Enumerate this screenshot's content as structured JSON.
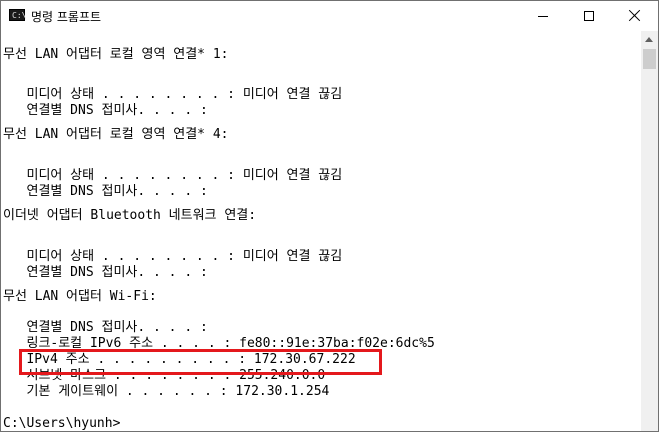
{
  "window": {
    "title": "명령 프롬프트",
    "icon_label": "C:\\",
    "icon": "console-app-icon"
  },
  "titlebar_buttons": {
    "minimize": "minimize-icon",
    "maximize": "maximize-icon",
    "close": "close-icon"
  },
  "console": {
    "lines": [
      "무선 LAN 어댑터 로컬 영역 연결* 1:",
      "",
      "   미디어 상태 . . . . . . . . : 미디어 연결 끊김",
      "   연결별 DNS 접미사. . . . :",
      "",
      "무선 LAN 어댑터 로컬 영역 연결* 4:",
      "",
      "   미디어 상태 . . . . . . . . : 미디어 연결 끊김",
      "   연결별 DNS 접미사. . . . :",
      "",
      "이더넷 어댑터 Bluetooth 네트워크 연결:",
      "",
      "   미디어 상태 . . . . . . . . : 미디어 연결 끊김",
      "   연결별 DNS 접미사. . . . :",
      "",
      "무선 LAN 어댑터 Wi-Fi:",
      "",
      "   연결별 DNS 접미사. . . . :",
      "   링크-로컬 IPv6 주소 . . . . : fe80::91e:37ba:f02e:6dc%5",
      "   IPv4 주소 . . . . . . . . . : 172.30.67.222",
      "   서브넷 마스크 . . . . . . . : 255.240.0.0",
      "   기본 게이트웨이 . . . . . . : 172.30.1.254",
      "",
      "C:\\Users\\hyunh>"
    ]
  },
  "colors": {
    "highlight_border": "#e4181c",
    "background": "#ffffff",
    "text": "#000000"
  }
}
